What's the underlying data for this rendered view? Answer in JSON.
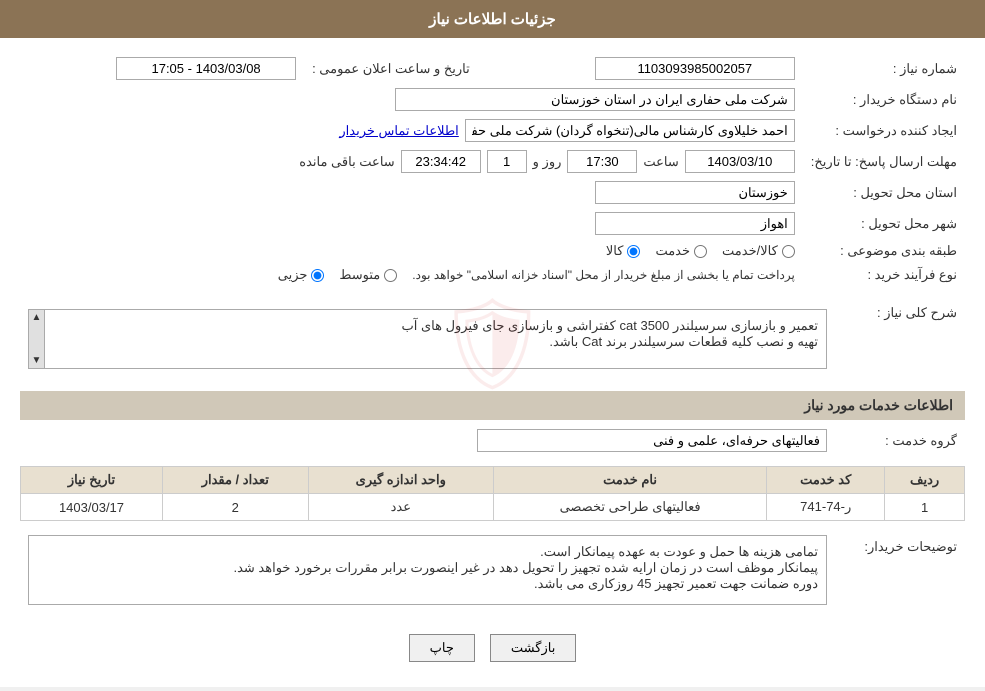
{
  "page": {
    "title": "جزئیات اطلاعات نیاز",
    "header_bg": "#8b7355"
  },
  "fields": {
    "shmare_niaz_label": "شماره نیاز :",
    "shmare_niaz_value": "1103093985002057",
    "nam_dastgah_label": "نام دستگاه خریدار :",
    "nam_dastgah_value": "شرکت ملی حفاری ایران در استان خوزستان",
    "ijad_konande_label": "ایجاد کننده درخواست :",
    "ijad_konande_value": "احمد خلیلاوی کارشناس مالی(تنخواه گردان) شرکت ملی حفاری ایران در استان",
    "ettelaat_tamas_label": "اطلاعات تماس خریدار",
    "mohlat_ersal_label": "مهلت ارسال پاسخ: تا تاریخ:",
    "tarikh_value": "1403/03/10",
    "saat_label": "ساعت",
    "saat_value": "17:30",
    "roz_label": "روز و",
    "roz_value": "1",
    "baqi_mande_label": "ساعت باقی مانده",
    "baqi_mande_value": "23:34:42",
    "ostan_label": "استان محل تحویل :",
    "ostan_value": "خوزستان",
    "shahr_label": "شهر محل تحویل :",
    "shahr_value": "اهواز",
    "tabaqe_label": "طبقه بندی موضوعی :",
    "tabaqe_kala": "کالا",
    "tabaqe_khadamat": "خدمت",
    "tabaqe_kala_khadamat": "کالا/خدمت",
    "tarikh_elan_label": "تاریخ و ساعت اعلان عمومی :",
    "tarikh_elan_value": "1403/03/08 - 17:05",
    "now_farayand_label": "نوع فرآیند خرید :",
    "jozei": "جزیی",
    "motevaset": "متوسط",
    "pardakht_text": "پرداخت تمام یا بخشی از مبلغ خریدار از محل \"اسناد خزانه اسلامی\" خواهد بود.",
    "sharh_niaz_label": "شرح کلی نیاز :",
    "sharh_niaz_line1": "تعمیر و بازسازی سرسیلندر 3500 cat کفتراشی و بازسازی جای فیرول های آب",
    "sharh_niaz_line2": "تهیه و نصب کلیه قطعات سرسیلندر برند Cat باشد.",
    "ettelaat_khadamat_label": "اطلاعات خدمات مورد نیاز",
    "grohe_khadamat_label": "گروه خدمت :",
    "grohe_khadamat_value": "فعالیتهای حرفه‌ای، علمی و فنی",
    "table": {
      "headers": [
        "ردیف",
        "کد خدمت",
        "نام خدمت",
        "واحد اندازه گیری",
        "تعداد / مقدار",
        "تاریخ نیاز"
      ],
      "rows": [
        {
          "radif": "1",
          "kod_khadamat": "ر-74-741",
          "nam_khadamat": "فعالیتهای طراحی تخصصی",
          "vahed": "عدد",
          "tedad": "2",
          "tarikh": "1403/03/17"
        }
      ]
    },
    "toshihat_label": "توضیحات خریدار:",
    "toshihat_line1": "تمامی هزینه ها حمل و عودت به عهده پیمانکار است.",
    "toshihat_line2": "پیمانکار موظف است در زمان ارایه شده تجهیز را تحویل دهد در غیر اینصورت برابر مقررات برخورد خواهد شد.",
    "toshihat_line3": "دوره ضمانت جهت تعمیر تجهیز 45 روزکاری می باشد.",
    "btn_back": "بازگشت",
    "btn_print": "چاپ"
  }
}
